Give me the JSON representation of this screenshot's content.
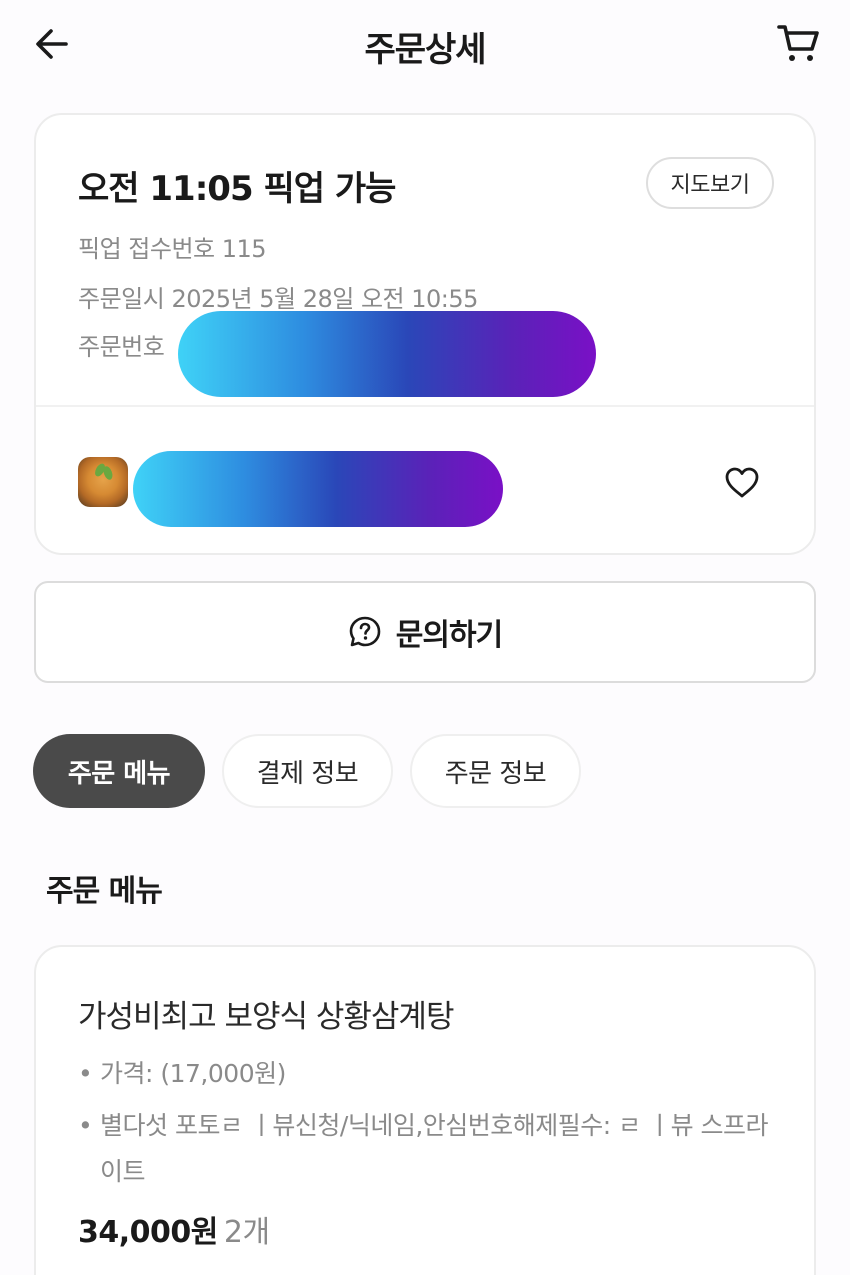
{
  "header": {
    "title": "주문상세",
    "back_icon": "arrow-left-icon",
    "cart_icon": "cart-icon"
  },
  "pickup": {
    "title": "오전 11:05 픽업 가능",
    "map_button": "지도보기",
    "pickup_number": "픽업 접수번호 115",
    "order_datetime": "주문일시 2025년 5월 28일 오전 10:55",
    "order_number_label": "주문번호",
    "heart_icon": "heart-outline-icon"
  },
  "inquiry": {
    "label": "문의하기",
    "icon": "question-chat-icon"
  },
  "tabs": [
    {
      "label": "주문 메뉴",
      "active": true
    },
    {
      "label": "결제 정보",
      "active": false
    },
    {
      "label": "주문 정보",
      "active": false
    }
  ],
  "order_menu": {
    "section_title": "주문 메뉴",
    "items": [
      {
        "name": "가성비최고 보양식 상황삼계탕",
        "options": [
          "가격: (17,000원)",
          "별다섯 포토ㄹ ㅣ뷰신청/닉네임,안심번호해제필수: ㄹ ㅣ뷰 스프라이트"
        ],
        "price": "34,000원",
        "quantity": "2개"
      }
    ]
  },
  "colors": {
    "tab_active_bg": "#4a4a4a",
    "redaction_gradient_start": "#3fd2f7",
    "redaction_gradient_end": "#7a10c6"
  }
}
